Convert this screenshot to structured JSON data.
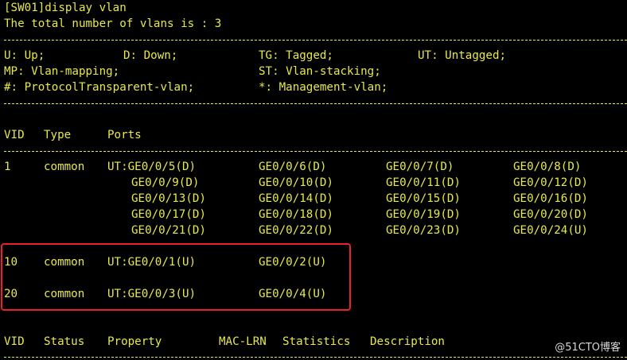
{
  "terminal": {
    "command_line": "[SW01]display vlan",
    "total_line": "The total number of vlans is : 3",
    "legend": {
      "row1": {
        "c1": "U: Up;",
        "c2": "D: Down;",
        "c3": "TG: Tagged;",
        "c4": "UT: Untagged;"
      },
      "row2": {
        "c1": "MP: Vlan-mapping;",
        "c3": "ST: Vlan-stacking;"
      },
      "row3": {
        "c1": "#: ProtocolTransparent-vlan;",
        "c3": "*: Management-vlan;"
      }
    },
    "vlan_table": {
      "headers": {
        "vid": "VID",
        "type": "Type",
        "ports": "Ports"
      },
      "rows": [
        {
          "vid": "1",
          "type": "common",
          "port_lines": [
            [
              "UT:GE0/0/5(D)",
              "GE0/0/6(D)",
              "GE0/0/7(D)",
              "GE0/0/8(D)"
            ],
            [
              "GE0/0/9(D)",
              "GE0/0/10(D)",
              "GE0/0/11(D)",
              "GE0/0/12(D)"
            ],
            [
              "GE0/0/13(D)",
              "GE0/0/14(D)",
              "GE0/0/15(D)",
              "GE0/0/16(D)"
            ],
            [
              "GE0/0/17(D)",
              "GE0/0/18(D)",
              "GE0/0/19(D)",
              "GE0/0/20(D)"
            ],
            [
              "GE0/0/21(D)",
              "GE0/0/22(D)",
              "GE0/0/23(D)",
              "GE0/0/24(U)"
            ]
          ]
        },
        {
          "vid": "10",
          "type": "common",
          "port_lines": [
            [
              "UT:GE0/0/1(U)",
              "GE0/0/2(U)"
            ]
          ]
        },
        {
          "vid": "20",
          "type": "common",
          "port_lines": [
            [
              "UT:GE0/0/3(U)",
              "GE0/0/4(U)"
            ]
          ]
        }
      ]
    },
    "status_table": {
      "headers": {
        "vid": "VID",
        "status": "Status",
        "property": "Property",
        "mac_lrn": "MAC-LRN",
        "statistics": "Statistics",
        "description": "Description"
      }
    }
  },
  "watermark": "@51CTO博客",
  "colors": {
    "background": "#000000",
    "text": "#e8e84a",
    "highlight_box": "#e8212a",
    "watermark": "#d8d8d8"
  }
}
